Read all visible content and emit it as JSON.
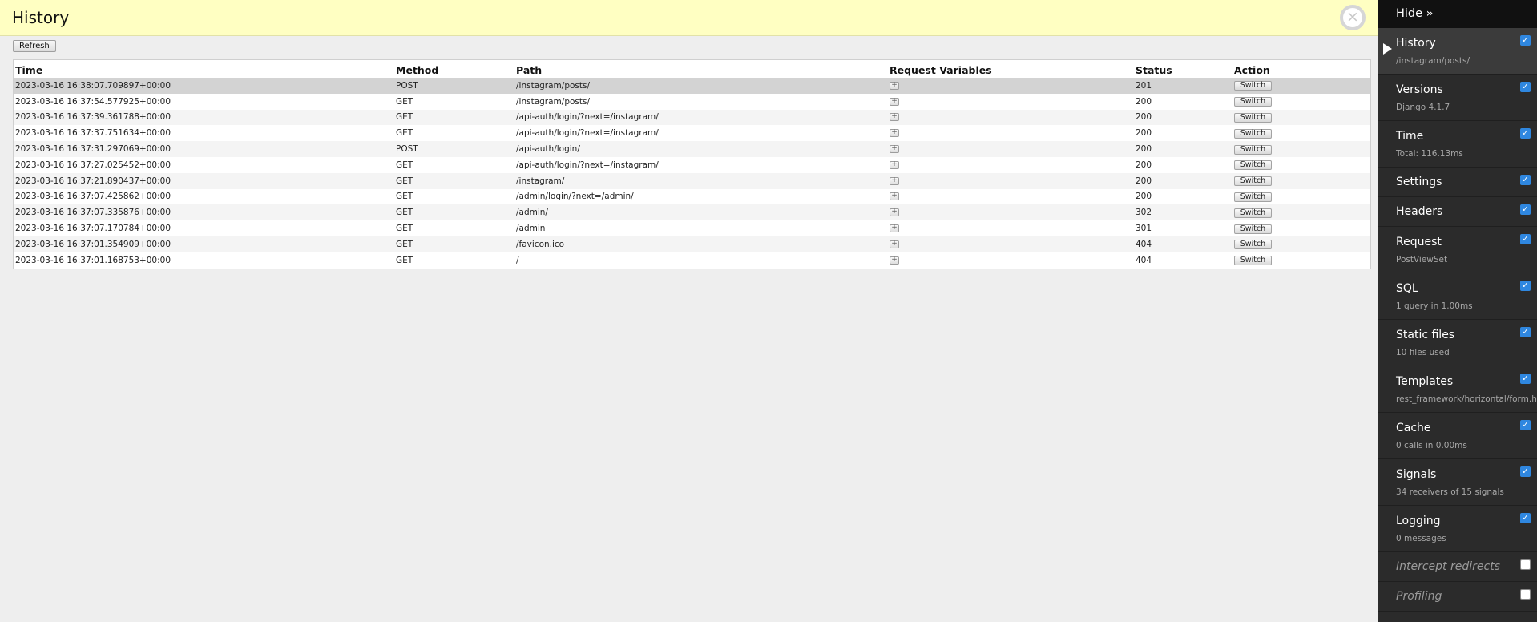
{
  "panel": {
    "title": "History",
    "close_glyph": "×",
    "refresh_label": "Refresh"
  },
  "table": {
    "headers": [
      "Time",
      "Method",
      "Path",
      "Request Variables",
      "Status",
      "Action"
    ],
    "vars_glyph": "+",
    "rows": [
      {
        "time": "2023-03-16 16:38:07.709897+00:00",
        "method": "POST",
        "path": "/instagram/posts/",
        "status": "201",
        "action": "Switch"
      },
      {
        "time": "2023-03-16 16:37:54.577925+00:00",
        "method": "GET",
        "path": "/instagram/posts/",
        "status": "200",
        "action": "Switch"
      },
      {
        "time": "2023-03-16 16:37:39.361788+00:00",
        "method": "GET",
        "path": "/api-auth/login/?next=/instagram/",
        "status": "200",
        "action": "Switch"
      },
      {
        "time": "2023-03-16 16:37:37.751634+00:00",
        "method": "GET",
        "path": "/api-auth/login/?next=/instagram/",
        "status": "200",
        "action": "Switch"
      },
      {
        "time": "2023-03-16 16:37:31.297069+00:00",
        "method": "POST",
        "path": "/api-auth/login/",
        "status": "200",
        "action": "Switch"
      },
      {
        "time": "2023-03-16 16:37:27.025452+00:00",
        "method": "GET",
        "path": "/api-auth/login/?next=/instagram/",
        "status": "200",
        "action": "Switch"
      },
      {
        "time": "2023-03-16 16:37:21.890437+00:00",
        "method": "GET",
        "path": "/instagram/",
        "status": "200",
        "action": "Switch"
      },
      {
        "time": "2023-03-16 16:37:07.425862+00:00",
        "method": "GET",
        "path": "/admin/login/?next=/admin/",
        "status": "200",
        "action": "Switch"
      },
      {
        "time": "2023-03-16 16:37:07.335876+00:00",
        "method": "GET",
        "path": "/admin/",
        "status": "302",
        "action": "Switch"
      },
      {
        "time": "2023-03-16 16:37:07.170784+00:00",
        "method": "GET",
        "path": "/admin",
        "status": "301",
        "action": "Switch"
      },
      {
        "time": "2023-03-16 16:37:01.354909+00:00",
        "method": "GET",
        "path": "/favicon.ico",
        "status": "404",
        "action": "Switch"
      },
      {
        "time": "2023-03-16 16:37:01.168753+00:00",
        "method": "GET",
        "path": "/",
        "status": "404",
        "action": "Switch"
      }
    ]
  },
  "toolbar": {
    "hide_label": "Hide »",
    "check_glyph": "✓",
    "panels": [
      {
        "id": "history",
        "title": "History",
        "subtitle": "/instagram/posts/",
        "checked": true,
        "active": true
      },
      {
        "id": "versions",
        "title": "Versions",
        "subtitle": "Django 4.1.7",
        "checked": true
      },
      {
        "id": "time",
        "title": "Time",
        "subtitle": "Total: 116.13ms",
        "checked": true
      },
      {
        "id": "settings",
        "title": "Settings",
        "subtitle": "",
        "checked": true
      },
      {
        "id": "headers",
        "title": "Headers",
        "subtitle": "",
        "checked": true
      },
      {
        "id": "request",
        "title": "Request",
        "subtitle": "PostViewSet",
        "checked": true
      },
      {
        "id": "sql",
        "title": "SQL",
        "subtitle": "1 query in 1.00ms",
        "checked": true
      },
      {
        "id": "static-files",
        "title": "Static files",
        "subtitle": "10 files used",
        "checked": true
      },
      {
        "id": "templates",
        "title": "Templates",
        "subtitle": "rest_framework/horizontal/form.html",
        "checked": true
      },
      {
        "id": "cache",
        "title": "Cache",
        "subtitle": "0 calls in 0.00ms",
        "checked": true
      },
      {
        "id": "signals",
        "title": "Signals",
        "subtitle": "34 receivers of 15 signals",
        "checked": true
      },
      {
        "id": "logging",
        "title": "Logging",
        "subtitle": "0 messages",
        "checked": true
      },
      {
        "id": "intercept-redirects",
        "title": "Intercept redirects",
        "subtitle": "",
        "checked": false,
        "disabled": true
      },
      {
        "id": "profiling",
        "title": "Profiling",
        "subtitle": "",
        "checked": false,
        "disabled": true
      }
    ]
  }
}
